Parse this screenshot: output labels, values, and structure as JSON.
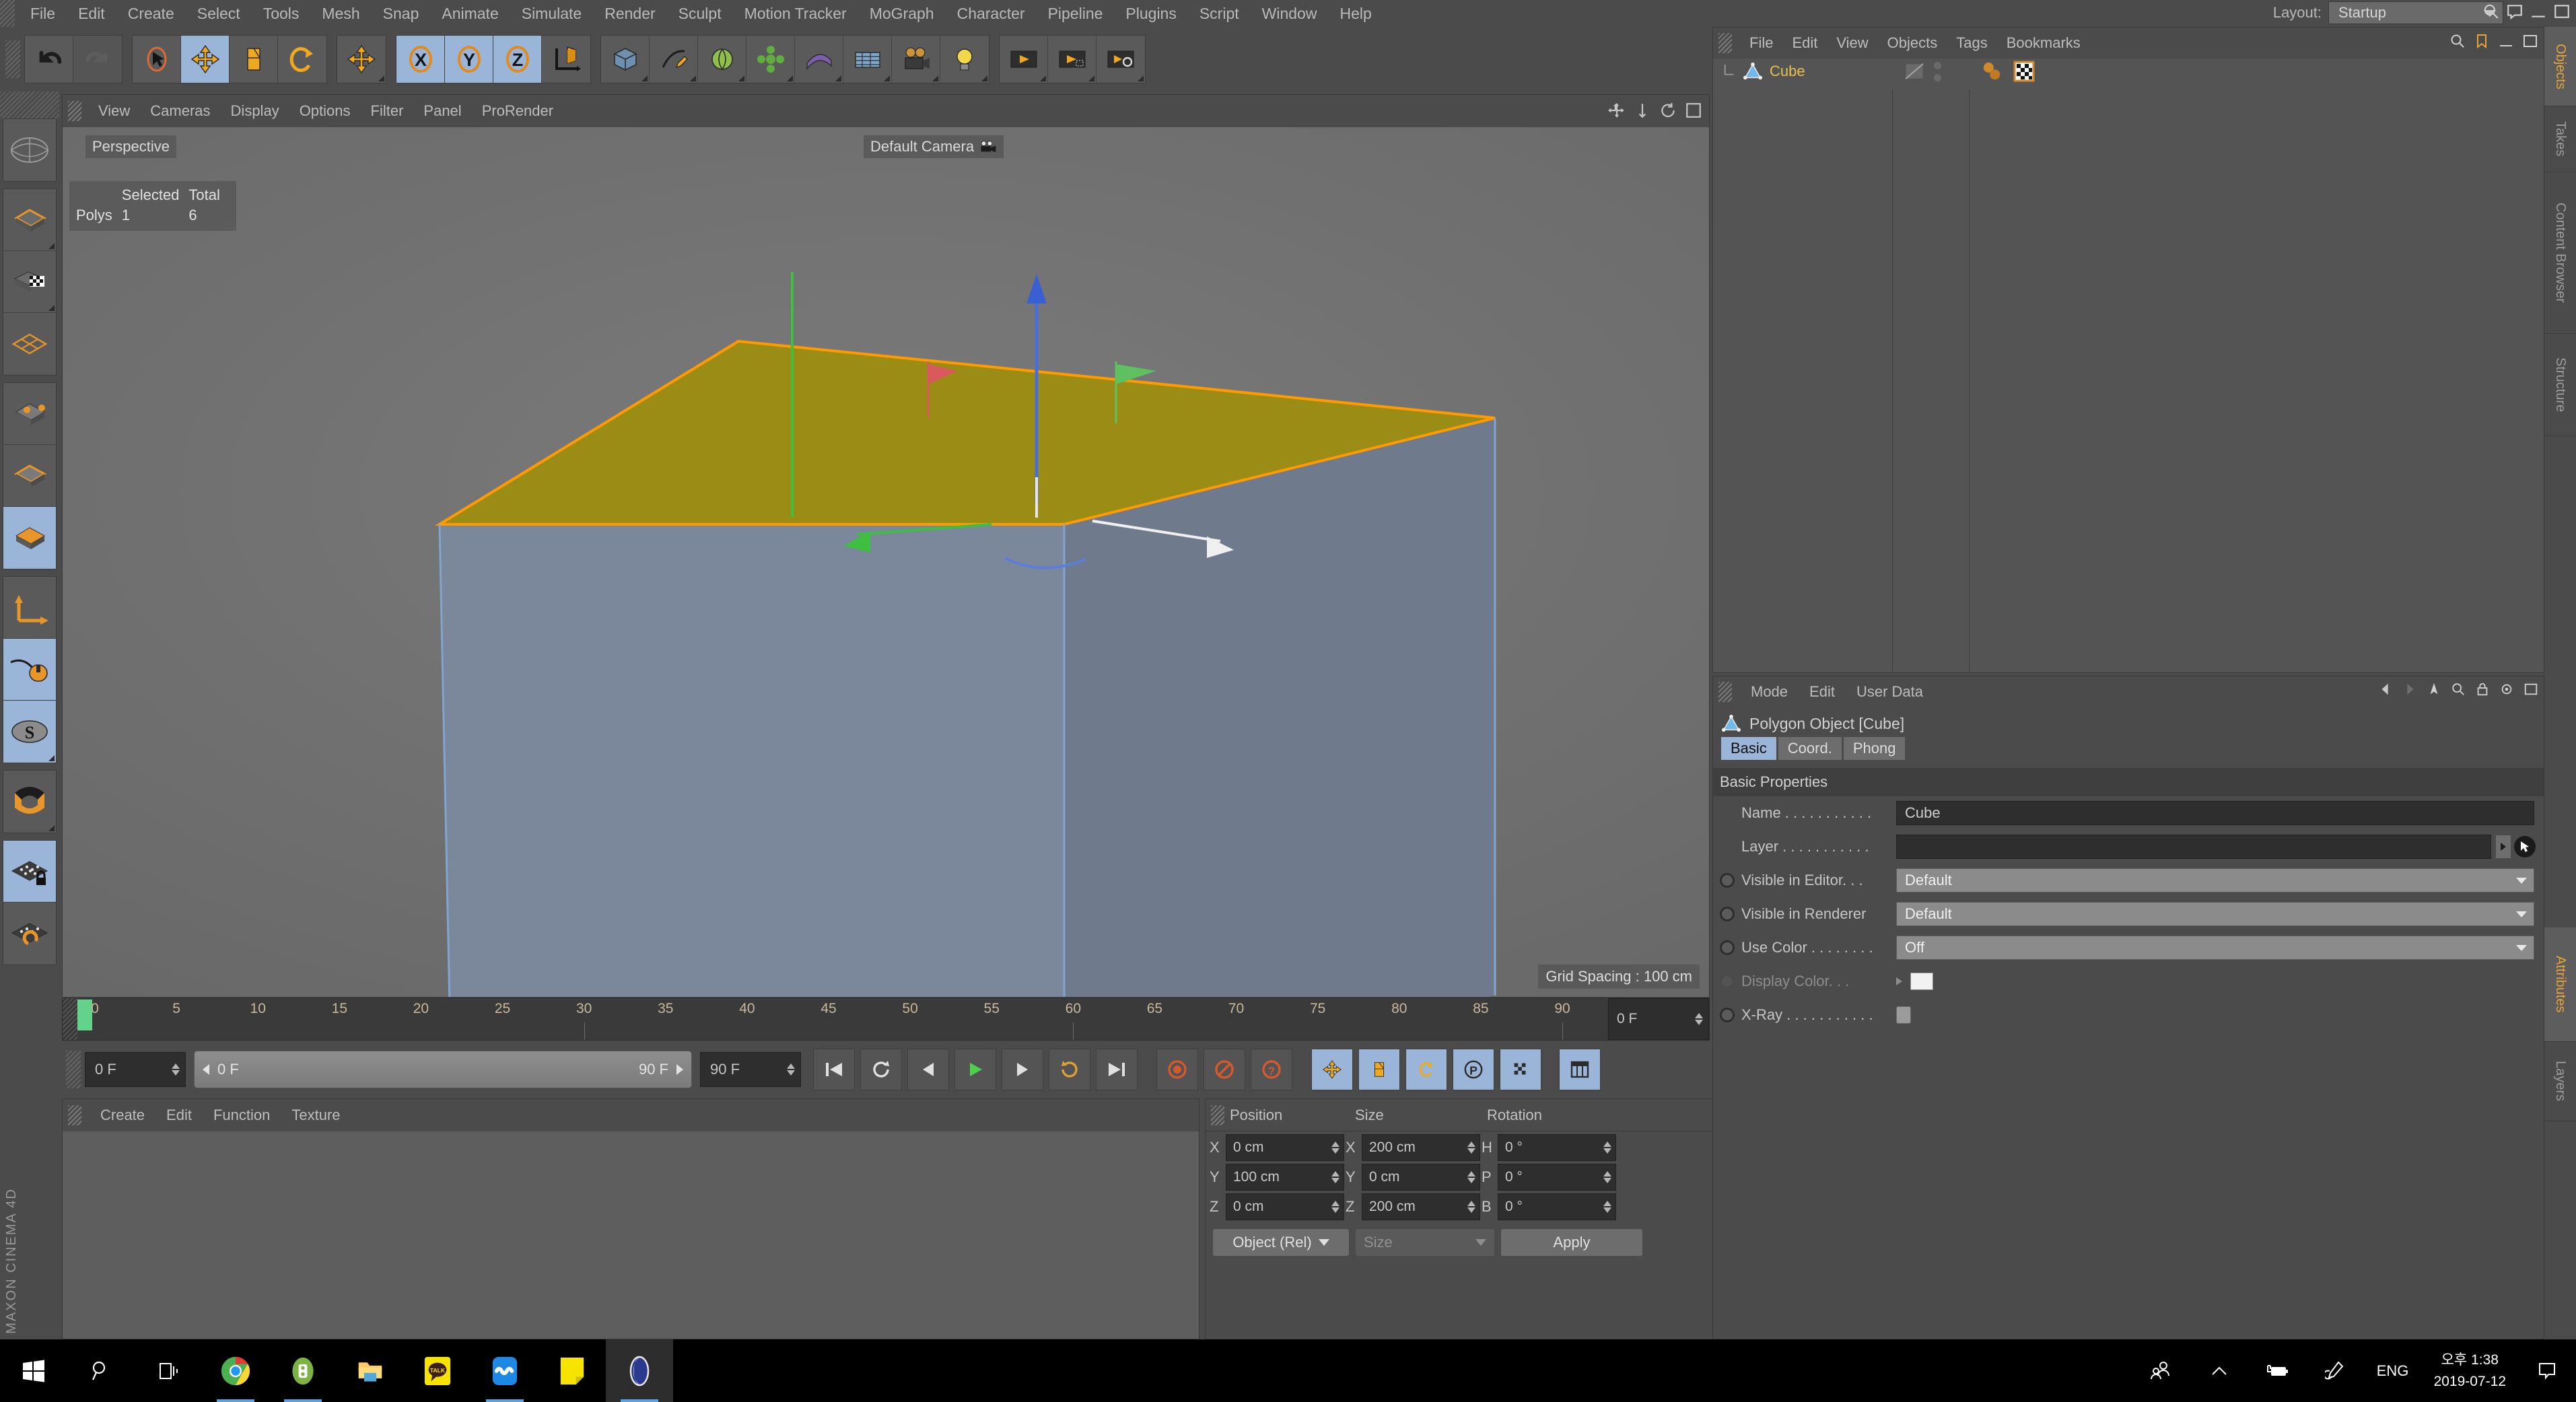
{
  "app": {
    "name": "MAXON CINEMA 4D"
  },
  "menubar": {
    "items": [
      "File",
      "Edit",
      "Create",
      "Select",
      "Tools",
      "Mesh",
      "Snap",
      "Animate",
      "Simulate",
      "Render",
      "Sculpt",
      "Motion Tracker",
      "MoGraph",
      "Character",
      "Pipeline",
      "Plugins",
      "Script",
      "Window",
      "Help"
    ],
    "layout_label": "Layout:",
    "layout_value": "Startup"
  },
  "toolbar": {
    "groups": [
      {
        "buttons": [
          {
            "name": "undo-icon",
            "state": "normal"
          },
          {
            "name": "redo-icon",
            "state": "disabled"
          }
        ]
      },
      {
        "buttons": [
          {
            "name": "live-selection-icon",
            "state": "normal"
          },
          {
            "name": "move-tool-icon",
            "state": "active"
          },
          {
            "name": "scale-tool-icon",
            "state": "normal"
          },
          {
            "name": "rotate-tool-icon",
            "state": "normal"
          }
        ]
      },
      {
        "buttons": [
          {
            "name": "move-alt-icon",
            "state": "normal"
          }
        ]
      },
      {
        "buttons": [
          {
            "name": "axis-x-icon",
            "label": "X",
            "state": "active"
          },
          {
            "name": "axis-y-icon",
            "label": "Y",
            "state": "active"
          },
          {
            "name": "axis-z-icon",
            "label": "Z",
            "state": "active"
          },
          {
            "name": "world-object-coordinate-icon",
            "state": "normal"
          }
        ]
      },
      {
        "buttons": [
          {
            "name": "cube-primitive-icon",
            "state": "normal"
          },
          {
            "name": "spline-pen-icon",
            "state": "normal"
          },
          {
            "name": "nurbs-icon",
            "state": "normal"
          },
          {
            "name": "array-icon",
            "state": "normal"
          },
          {
            "name": "deformer-icon",
            "state": "normal"
          },
          {
            "name": "environment-icon",
            "state": "normal"
          },
          {
            "name": "camera-icon",
            "state": "normal"
          },
          {
            "name": "light-icon",
            "state": "normal"
          }
        ]
      },
      {
        "buttons": [
          {
            "name": "render-view-icon",
            "state": "normal"
          },
          {
            "name": "render-region-icon",
            "state": "normal"
          },
          {
            "name": "render-settings-icon",
            "state": "normal"
          }
        ]
      }
    ]
  },
  "left_palette": {
    "groups": [
      {
        "buttons": [
          {
            "name": "undo-view-icon"
          }
        ]
      },
      {
        "buttons": [
          {
            "name": "viewport-globe-icon"
          }
        ]
      },
      {
        "buttons": [
          {
            "name": "point-mode-icon",
            "state": "normal"
          },
          {
            "name": "edge-mode-icon",
            "state": "normal"
          },
          {
            "name": "polygon-mode-icon",
            "state": "normal"
          }
        ]
      },
      {
        "buttons": [
          {
            "name": "model-mode-icon",
            "state": "normal"
          },
          {
            "name": "object-mode-icon",
            "state": "normal"
          },
          {
            "name": "texture-mode-icon",
            "state": "active"
          }
        ]
      },
      {
        "buttons": [
          {
            "name": "world-axis-icon",
            "state": "normal"
          },
          {
            "name": "enable-axis-icon",
            "state": "active"
          },
          {
            "name": "scale-lock-icon",
            "state": "active"
          }
        ]
      },
      {
        "buttons": [
          {
            "name": "snap-magnet-icon",
            "state": "normal"
          }
        ]
      },
      {
        "buttons": [
          {
            "name": "lock-workplane-icon",
            "state": "active"
          },
          {
            "name": "planar-workplane-icon",
            "state": "normal"
          }
        ]
      }
    ]
  },
  "viewport": {
    "menu": [
      "View",
      "Cameras",
      "Display",
      "Options",
      "Filter",
      "Panel",
      "ProRender"
    ],
    "label_perspective": "Perspective",
    "label_camera": "Default Camera",
    "hud": {
      "col_selected": "Selected",
      "col_total": "Total",
      "row_label": "Polys",
      "selected": "1",
      "total": "6"
    },
    "grid_spacing": "Grid Spacing : 100 cm"
  },
  "timeline": {
    "ticks": [
      "0",
      "5",
      "10",
      "15",
      "20",
      "25",
      "30",
      "35",
      "40",
      "45",
      "50",
      "55",
      "60",
      "65",
      "70",
      "75",
      "80",
      "85",
      "90"
    ],
    "current_frame": "0 F"
  },
  "animbar": {
    "current_frame": "0 F",
    "range_start": "0 F",
    "range_end": "90 F",
    "max_frame": "90 F",
    "buttons": [
      {
        "name": "go-to-start-button"
      },
      {
        "name": "play-backwards-loop-button"
      },
      {
        "name": "step-back-button"
      },
      {
        "name": "play-forward-button"
      },
      {
        "name": "step-forward-button"
      },
      {
        "name": "loop-playback-button"
      },
      {
        "name": "go-to-end-button"
      },
      {
        "name": "record-active-objects-button"
      },
      {
        "name": "autokeying-button"
      },
      {
        "name": "keyframe-selection-button"
      },
      {
        "name": "position-key-button"
      },
      {
        "name": "scale-key-button"
      },
      {
        "name": "rotation-key-button"
      },
      {
        "name": "parameter-key-button"
      },
      {
        "name": "point-level-animation-button"
      },
      {
        "name": "timeline-settings-button"
      }
    ]
  },
  "material_manager": {
    "menu": [
      "Create",
      "Edit",
      "Function",
      "Texture"
    ]
  },
  "coordinates": {
    "headers": [
      "Position",
      "Size",
      "Rotation"
    ],
    "rows": [
      {
        "pos_axis": "X",
        "pos_value": "0 cm",
        "size_axis": "X",
        "size_value": "200 cm",
        "rot_axis": "H",
        "rot_value": "0 °"
      },
      {
        "pos_axis": "Y",
        "pos_value": "100 cm",
        "size_axis": "Y",
        "size_value": "0 cm",
        "rot_axis": "P",
        "rot_value": "0 °"
      },
      {
        "pos_axis": "Z",
        "pos_value": "0 cm",
        "size_axis": "Z",
        "size_value": "200 cm",
        "rot_axis": "B",
        "rot_value": "0 °"
      }
    ],
    "mode_dropdown": "Object (Rel)",
    "size_dropdown": "Size",
    "apply_button": "Apply"
  },
  "object_manager": {
    "menu": [
      "File",
      "Edit",
      "View",
      "Objects",
      "Tags",
      "Bookmarks"
    ],
    "objects": [
      {
        "name": "Cube",
        "tags": [
          "material-tag",
          "texture-tag"
        ]
      }
    ]
  },
  "attribute_manager": {
    "menu": [
      "Mode",
      "Edit",
      "User Data"
    ],
    "title": "Polygon Object [Cube]",
    "tabs": [
      {
        "label": "Basic",
        "selected": true
      },
      {
        "label": "Coord.",
        "selected": false
      },
      {
        "label": "Phong",
        "selected": false
      }
    ],
    "section": "Basic Properties",
    "properties": [
      {
        "label": "Name . . . . . . . . . . .",
        "type": "text",
        "value": "Cube",
        "enabled": true
      },
      {
        "label": "Layer . . . . . . . . . . .",
        "type": "link",
        "value": "",
        "enabled": true
      },
      {
        "label": "Visible in Editor. . .",
        "type": "select",
        "value": "Default",
        "enabled": true
      },
      {
        "label": "Visible in Renderer",
        "type": "select",
        "value": "Default",
        "enabled": true
      },
      {
        "label": "Use Color . . . . . . . .",
        "type": "select",
        "value": "Off",
        "enabled": true
      },
      {
        "label": "Display Color. . .",
        "type": "color",
        "value": "#f2f2f2",
        "enabled": false
      },
      {
        "label": "X-Ray . . . . . . . . . . .",
        "type": "check",
        "value": "",
        "enabled": true
      }
    ]
  },
  "right_tabs": [
    {
      "label": "Objects",
      "selected": true
    },
    {
      "label": "Takes",
      "selected": false
    },
    {
      "label": "Content Browser",
      "selected": false
    },
    {
      "label": "Structure",
      "selected": false
    },
    {
      "label": "Attributes",
      "selected": true
    },
    {
      "label": "Layers",
      "selected": false
    }
  ],
  "taskbar": {
    "icons": [
      {
        "name": "windows-start-icon"
      },
      {
        "name": "search-icon"
      },
      {
        "name": "task-view-icon"
      },
      {
        "name": "chrome-icon",
        "running": true
      },
      {
        "name": "alsee-icon",
        "running": true
      },
      {
        "name": "file-explorer-icon",
        "running": false
      },
      {
        "name": "kakaotalk-icon",
        "running": false
      },
      {
        "name": "bandizip-icon",
        "running": true
      },
      {
        "name": "memo-icon",
        "running": false
      },
      {
        "name": "cinema4d-icon",
        "running": true,
        "active": true
      }
    ],
    "tray": [
      {
        "name": "people-icon"
      },
      {
        "name": "show-hidden-icons-icon"
      },
      {
        "name": "battery-icon"
      },
      {
        "name": "pen-icon"
      },
      {
        "name": "language-icon",
        "label": "ENG"
      }
    ],
    "clock_time": "오후 1:38",
    "clock_date": "2019-07-12",
    "action_center": "notification-icon"
  },
  "colors": {
    "panel_bg": "#4b4b4b",
    "accent_blue": "#9bb5d8",
    "accent_orange": "#e8a33a",
    "cube_top": "#9b8c16",
    "cube_side": "#7e8b9e",
    "selection_outline": "#ff9a00"
  }
}
